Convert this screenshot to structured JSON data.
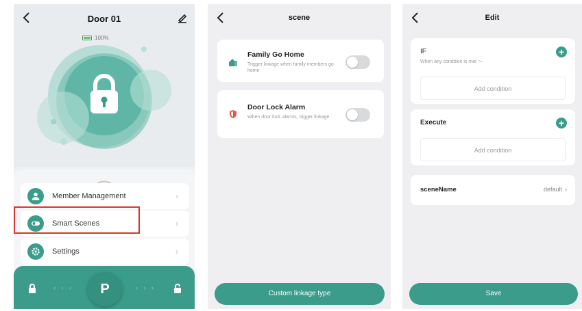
{
  "colors": {
    "accent": "#3b9c8c",
    "highlight_border": "#d6362d",
    "battery": "#6cc071"
  },
  "device_panel": {
    "title": "Door 01",
    "back_icon": "chevron-left-icon",
    "edit_icon": "pencil-icon",
    "battery_level": "100%",
    "menu": [
      {
        "label": "Member Management",
        "icon": "user-icon"
      },
      {
        "label": "Smart Scenes",
        "icon": "toggle-icon"
      },
      {
        "label": "Settings",
        "icon": "gear-icon"
      }
    ],
    "slider": {
      "left_arrows": "‹ ‹ ‹",
      "right_arrows": "› › ›",
      "knob_label": "P"
    }
  },
  "scene_panel": {
    "title": "scene",
    "scenes": [
      {
        "title": "Family Go Home",
        "description": "Trigger linkage when family members go home",
        "icon": "home-icon",
        "enabled": false
      },
      {
        "title": "Door Lock Alarm",
        "description": "When door lock alarms, trigger linkage",
        "icon": "shield-icon",
        "enabled": false
      }
    ],
    "custom_button": "Custom linkage type"
  },
  "edit_panel": {
    "title": "Edit",
    "if_section": {
      "title": "IF",
      "subtitle": "When any condition is met ～",
      "add_label": "Add condition"
    },
    "execute_section": {
      "title": "Execute",
      "add_label": "Add condition"
    },
    "scene_name": {
      "label": "sceneName",
      "value": "default"
    },
    "save_button": "Save"
  }
}
